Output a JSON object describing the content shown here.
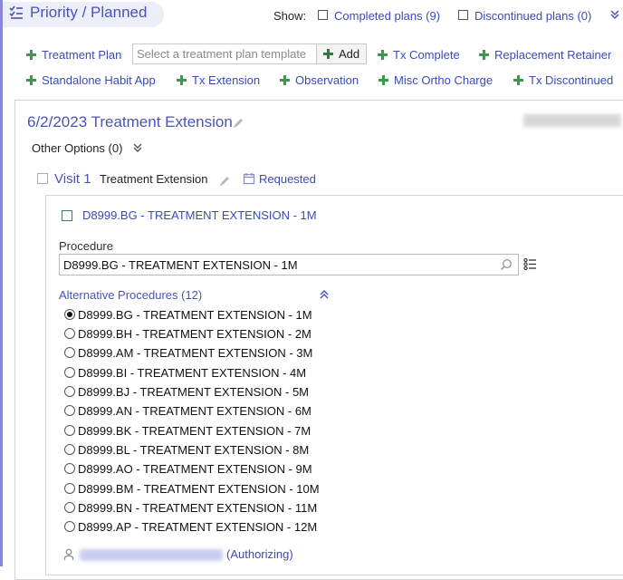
{
  "header": {
    "title": "Priority / Planned",
    "show_label": "Show:",
    "completed_plans": "Completed plans (9)",
    "discontinued_plans": "Discontinued plans (0)"
  },
  "actions": {
    "row1": [
      "Treatment Plan",
      "Tx Complete",
      "Replacement Retainer"
    ],
    "row2": [
      "Standalone Habit App",
      "Tx Extension",
      "Observation",
      "Misc Ortho Charge",
      "Tx Discontinued"
    ],
    "template_placeholder": "Select a treatment plan template",
    "add_label": "Add"
  },
  "plan": {
    "title": "6/2/2023 Treatment Extension",
    "other_options": "Other Options  (0)"
  },
  "visit": {
    "number": "Visit 1",
    "name": "Treatment Extension",
    "status": "Requested"
  },
  "procedure": {
    "title": "D8999.BG - TREATMENT EXTENSION - 1M",
    "field_label": "Procedure",
    "field_value": "D8999.BG - TREATMENT EXTENSION - 1M",
    "alternatives_label": "Alternative Procedures (12)",
    "alternatives": [
      {
        "label": "D8999.BG - TREATMENT EXTENSION - 1M",
        "selected": true
      },
      {
        "label": "D8999.BH - TREATMENT EXTENSION - 2M",
        "selected": false
      },
      {
        "label": "D8999.AM - TREATMENT EXTENSION - 3M",
        "selected": false
      },
      {
        "label": "D8999.BI - TREATMENT EXTENSION - 4M",
        "selected": false
      },
      {
        "label": "D8999.BJ - TREATMENT EXTENSION - 5M",
        "selected": false
      },
      {
        "label": "D8999.AN - TREATMENT EXTENSION - 6M",
        "selected": false
      },
      {
        "label": "D8999.BK - TREATMENT EXTENSION - 7M",
        "selected": false
      },
      {
        "label": "D8999.BL - TREATMENT EXTENSION - 8M",
        "selected": false
      },
      {
        "label": "D8999.AO - TREATMENT EXTENSION - 9M",
        "selected": false
      },
      {
        "label": "D8999.BM - TREATMENT EXTENSION - 10M",
        "selected": false
      },
      {
        "label": "D8999.BN - TREATMENT EXTENSION - 11M",
        "selected": false
      },
      {
        "label": "D8999.AP - TREATMENT EXTENSION - 12M",
        "selected": false
      }
    ],
    "authorizing_label": "(Authorizing)"
  },
  "icons": {
    "title": "checklist-icon",
    "edit": "pencil-icon",
    "calendar": "calendar-icon",
    "search": "search-icon",
    "list": "list-icon",
    "provider": "person-icon",
    "plus": "plus-icon",
    "expand": "double-chevron-down-icon",
    "collapse": "double-chevron-up-icon"
  },
  "colors": {
    "accent": "#4a54b8",
    "link": "#3a4bb8",
    "plus_green": "#3a9a4a",
    "title_bg": "#eceef8"
  }
}
